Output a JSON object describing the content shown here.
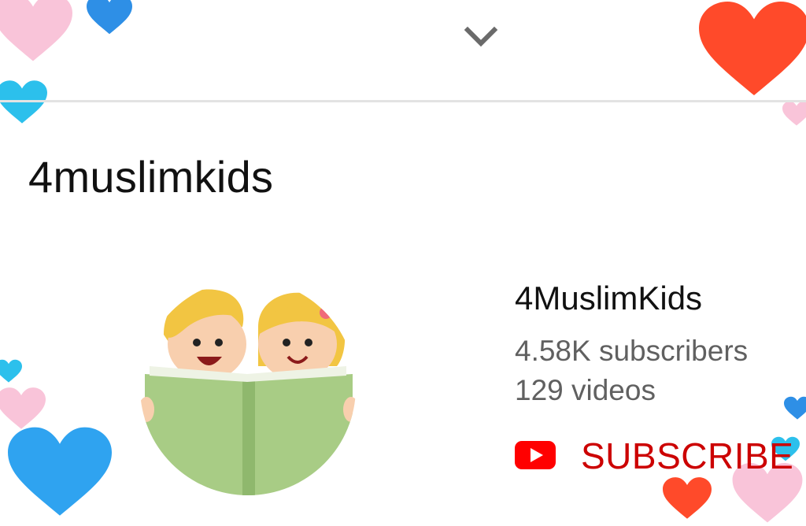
{
  "header": {
    "collapse_icon": "chevron-down-icon"
  },
  "page": {
    "title": "4muslimkids"
  },
  "channel": {
    "name": "4MuslimKids",
    "subscribers": "4.58K subscribers",
    "videos": "129 videos",
    "avatar_icon": "kids-reading-book-avatar"
  },
  "subscribe": {
    "label": "SUBSCRIBE",
    "icon": "youtube-play-icon"
  },
  "colors": {
    "subscribe_red": "#cc0000",
    "youtube_red": "#ff0000",
    "secondary_text": "#606060",
    "heart_pink": "#f9c4d9",
    "heart_blue": "#2fa3f0",
    "heart_orange": "#ff4a2a",
    "book_green": "#a8cc85"
  }
}
